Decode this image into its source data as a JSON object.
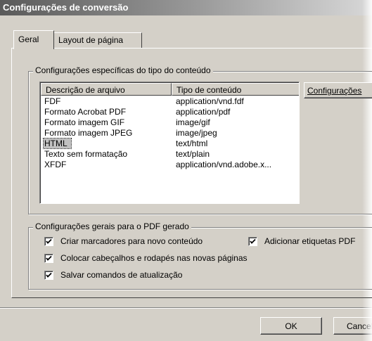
{
  "window": {
    "title": "Configurações de conversão"
  },
  "tabs": [
    {
      "label": "Geral",
      "active": true
    },
    {
      "label": "Layout de página",
      "active": false
    }
  ],
  "content_group": {
    "legend": "Configurações específicas do tipo do conteúdo",
    "columns": [
      "Descrição de arquivo",
      "Tipo de conteúdo"
    ],
    "rows": [
      {
        "desc": "FDF",
        "type": "application/vnd.fdf"
      },
      {
        "desc": "Formato Acrobat PDF",
        "type": "application/pdf"
      },
      {
        "desc": "Formato imagem GIF",
        "type": "image/gif"
      },
      {
        "desc": "Formato imagem JPEG",
        "type": "image/jpeg"
      },
      {
        "desc": "HTML",
        "type": "text/html",
        "selected": true
      },
      {
        "desc": "Texto sem formatação",
        "type": "text/plain"
      },
      {
        "desc": "XFDF",
        "type": "application/vnd.adobe.x..."
      }
    ],
    "settings_button": "Configurações"
  },
  "general_group": {
    "legend": "Configurações gerais para o PDF gerado",
    "checkboxes": [
      {
        "label": "Criar marcadores para novo conteúdo",
        "checked": true
      },
      {
        "label": "Adicionar etiquetas PDF",
        "checked": true
      },
      {
        "label": "Colocar cabeçalhos e rodapés nas novas páginas",
        "checked": true
      },
      {
        "label": "Salvar comandos de atualização",
        "checked": true
      }
    ]
  },
  "footer": {
    "ok_label": "OK",
    "cancel_label": "Cancelar"
  }
}
